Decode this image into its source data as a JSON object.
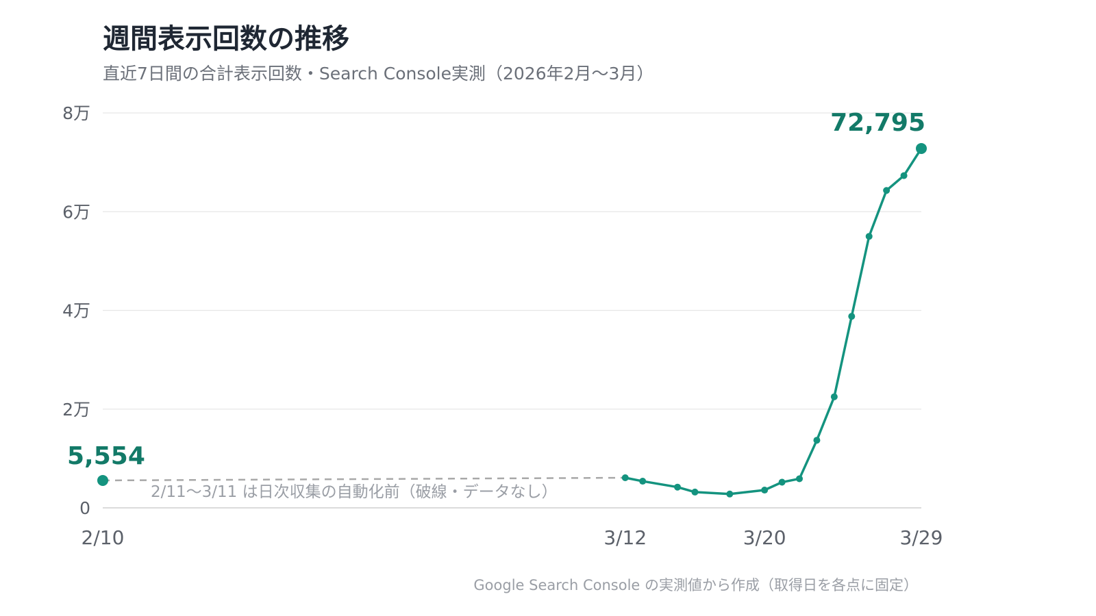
{
  "colors": {
    "accent": "#14937f",
    "accent_dark": "#137a68"
  },
  "chart_data": {
    "type": "line",
    "title": "週間表示回数の推移",
    "subtitle": "直近7日間の合計表示回数・Search Console実測（2026年2月〜3月）",
    "xlabel": "",
    "ylabel": "",
    "ylim": [
      0,
      80000
    ],
    "xlim": [
      "2026-02-10",
      "2026-03-29"
    ],
    "grid": true,
    "y_ticks": [
      {
        "value": 0,
        "label": "0"
      },
      {
        "value": 20000,
        "label": "2万"
      },
      {
        "value": 40000,
        "label": "4万"
      },
      {
        "value": 60000,
        "label": "6万"
      },
      {
        "value": 80000,
        "label": "8万"
      }
    ],
    "x_ticks": [
      {
        "date": "2026-02-10",
        "label": "2/10"
      },
      {
        "date": "2026-03-12",
        "label": "3/12"
      },
      {
        "date": "2026-03-20",
        "label": "3/20"
      },
      {
        "date": "2026-03-29",
        "label": "3/29"
      }
    ],
    "series": [
      {
        "points": [
          {
            "date": "2026-02-10",
            "value": 5554
          },
          {
            "date": "2026-03-12",
            "value": 6100
          },
          {
            "date": "2026-03-13",
            "value": 5400
          },
          {
            "date": "2026-03-15",
            "value": 4200
          },
          {
            "date": "2026-03-16",
            "value": 3200
          },
          {
            "date": "2026-03-18",
            "value": 2800
          },
          {
            "date": "2026-03-20",
            "value": 3600
          },
          {
            "date": "2026-03-21",
            "value": 5200
          },
          {
            "date": "2026-03-22",
            "value": 5900
          },
          {
            "date": "2026-03-23",
            "value": 13700
          },
          {
            "date": "2026-03-24",
            "value": 22500
          },
          {
            "date": "2026-03-25",
            "value": 38800
          },
          {
            "date": "2026-03-26",
            "value": 55000
          },
          {
            "date": "2026-03-27",
            "value": 64300
          },
          {
            "date": "2026-03-28",
            "value": 67300
          },
          {
            "date": "2026-03-29",
            "value": 72795
          }
        ]
      }
    ],
    "gap": {
      "from": "2026-02-10",
      "to": "2026-03-12",
      "note": "2/11〜3/11 は日次収集の自動化前（破線・データなし）"
    },
    "annotations": [
      {
        "date": "2026-02-10",
        "value": 5554,
        "text": "5,554"
      },
      {
        "date": "2026-03-29",
        "value": 72795,
        "text": "72,795"
      }
    ],
    "source": "Google Search Console の実測値から作成（取得日を各点に固定）"
  }
}
